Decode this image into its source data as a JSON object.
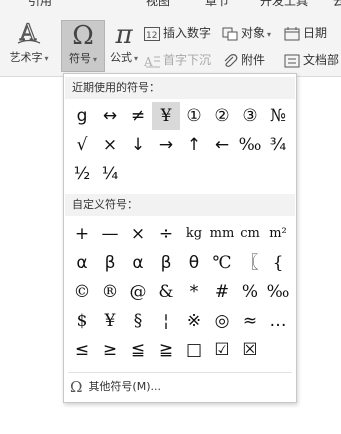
{
  "ribbon": {
    "tabs": [
      "引用",
      "视图",
      "章节",
      "开发工具",
      "云"
    ],
    "art_text": {
      "label": "艺术字",
      "icon": "art-text-icon"
    },
    "symbol": {
      "label": "符号",
      "icon": "omega-icon"
    },
    "formula": {
      "label": "公式",
      "icon": "pi-icon"
    },
    "insert_number": "插入数字",
    "object": "对象",
    "date": "日期",
    "drop_cap": "首字下沉",
    "attachment": "附件",
    "text_part": "文档部"
  },
  "symbols_panel": {
    "recent_title": "近期使用的符号：",
    "recent": [
      "g",
      "↔",
      "≠",
      "¥",
      "①",
      "②",
      "③",
      "№",
      "√",
      "×",
      "↓",
      "→",
      "↑",
      "←",
      "‰",
      "¾",
      "½",
      "¼"
    ],
    "selected_symbol": "¥",
    "custom_title": "自定义符号：",
    "custom": [
      "+",
      "—",
      "×",
      "÷",
      "kg",
      "mm",
      "cm",
      "m²",
      "α",
      "β",
      "α",
      "β",
      "θ",
      "℃",
      "〖",
      "{",
      "©",
      "®",
      "@",
      "&",
      "*",
      "#",
      "%",
      "‰",
      "$",
      "¥",
      "§",
      "¦",
      "※",
      "◎",
      "≈",
      "…",
      "≤",
      "≥",
      "≦",
      "≧",
      "□",
      "☑",
      "☒"
    ],
    "more_label": "其他符号(M)..."
  }
}
